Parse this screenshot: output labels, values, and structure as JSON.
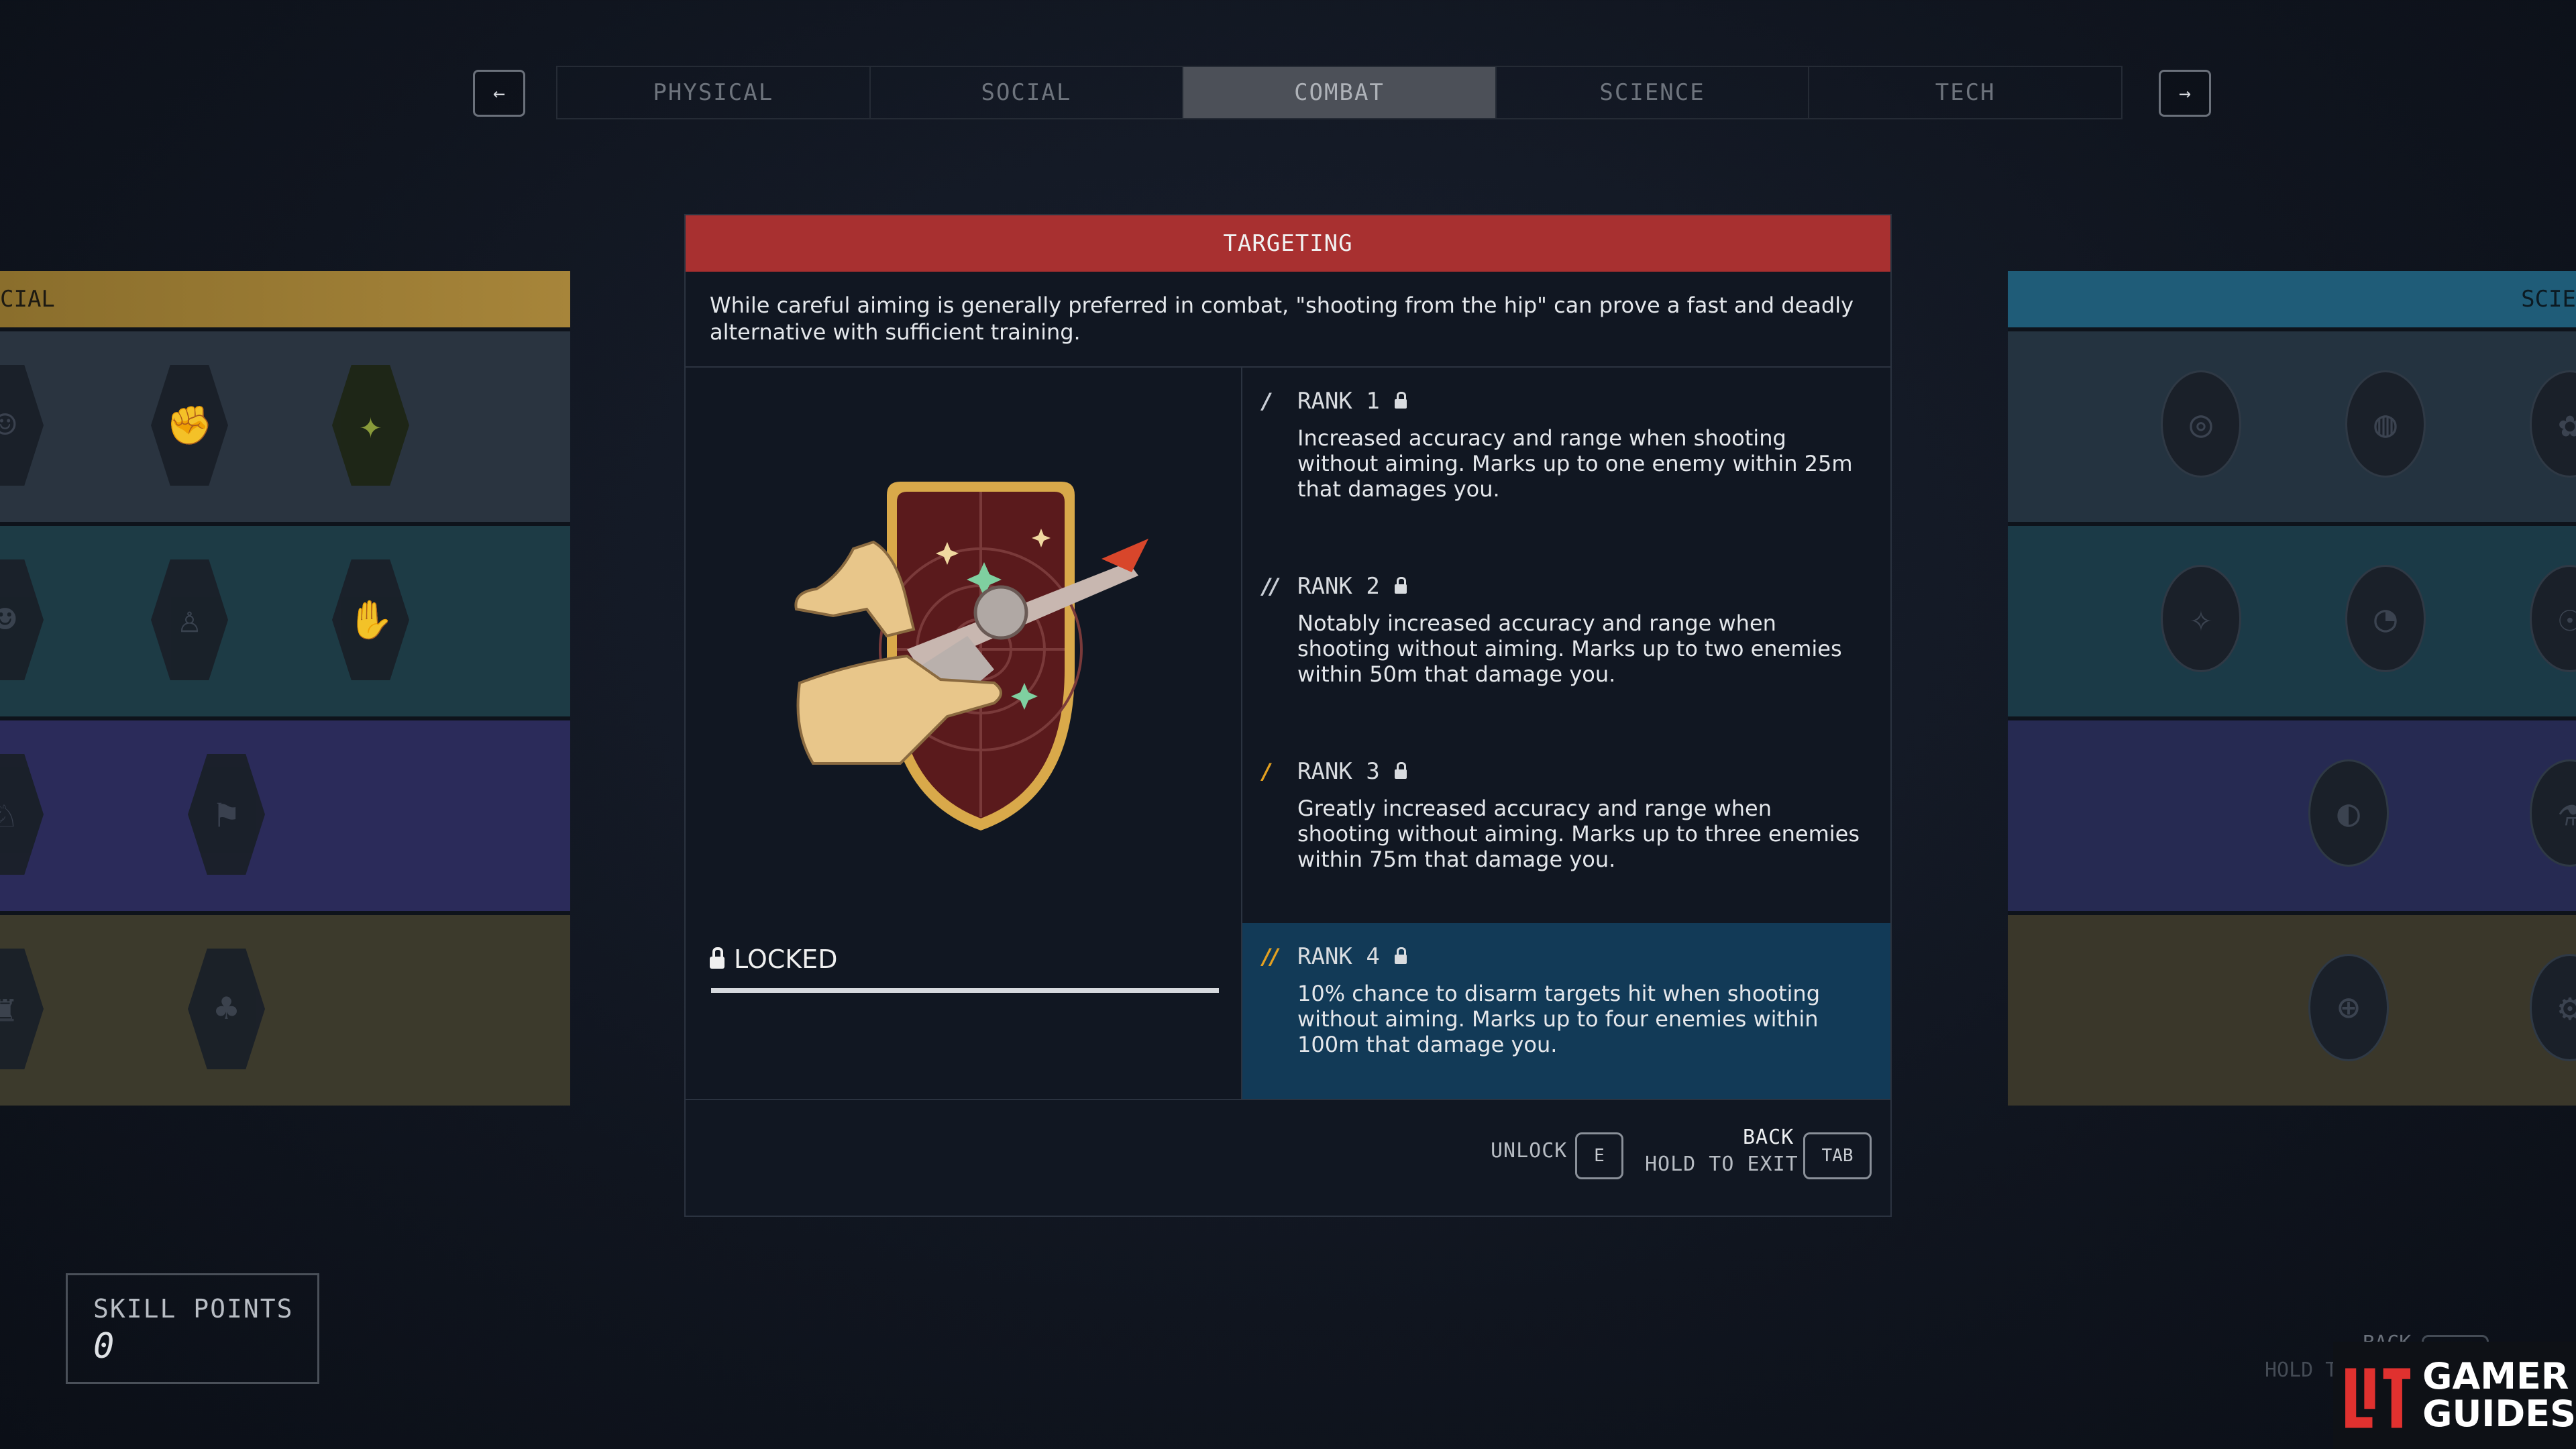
{
  "tabs": [
    {
      "label": "PHYSICAL",
      "active": false
    },
    {
      "label": "SOCIAL",
      "active": false
    },
    {
      "label": "COMBAT",
      "active": true
    },
    {
      "label": "SCIENCE",
      "active": false
    },
    {
      "label": "TECH",
      "active": false
    }
  ],
  "nav": {
    "prev_icon": "←",
    "next_icon": "→"
  },
  "left_panel": {
    "header": "CIAL"
  },
  "right_panel": {
    "header": "SCIE"
  },
  "perk": {
    "title": "TARGETING",
    "description": "While careful aiming is generally preferred in combat, \"shooting from the hip\" can prove a fast and deadly alternative with sufficient training.",
    "status": "LOCKED",
    "ranks": [
      {
        "label": "RANK 1",
        "text": "Increased accuracy and range when shooting without aiming. Marks up to one enemy within 25m that damages you."
      },
      {
        "label": "RANK 2",
        "text": "Notably increased accuracy and range when shooting without aiming. Marks up to two enemies within 50m that damage you."
      },
      {
        "label": "RANK 3",
        "text": "Greatly increased accuracy and range when shooting without aiming. Marks up to three enemies within 75m that damage you."
      },
      {
        "label": "RANK 4",
        "text": "10% chance to disarm targets hit when shooting without aiming. Marks up to four enemies within 100m that damage you."
      }
    ]
  },
  "footer": {
    "unlock_label": "UNLOCK",
    "unlock_key": "E",
    "back_label": "BACK",
    "hold_label": "HOLD TO EXIT",
    "tab_key": "TAB"
  },
  "skill_points": {
    "label": "SKILL POINTS",
    "value": "0"
  },
  "ghost": {
    "back": "BACK",
    "hold": "HOLD T",
    "tab": "TAB"
  },
  "watermark": {
    "line1": "GAMER",
    "line2": "GUIDES"
  },
  "colors": {
    "header_red": "#a83030",
    "highlight_blue": "#123a57",
    "rank_gold": "#e3a020",
    "social_gold": "#a7853a",
    "science_blue": "#1f5c78"
  }
}
